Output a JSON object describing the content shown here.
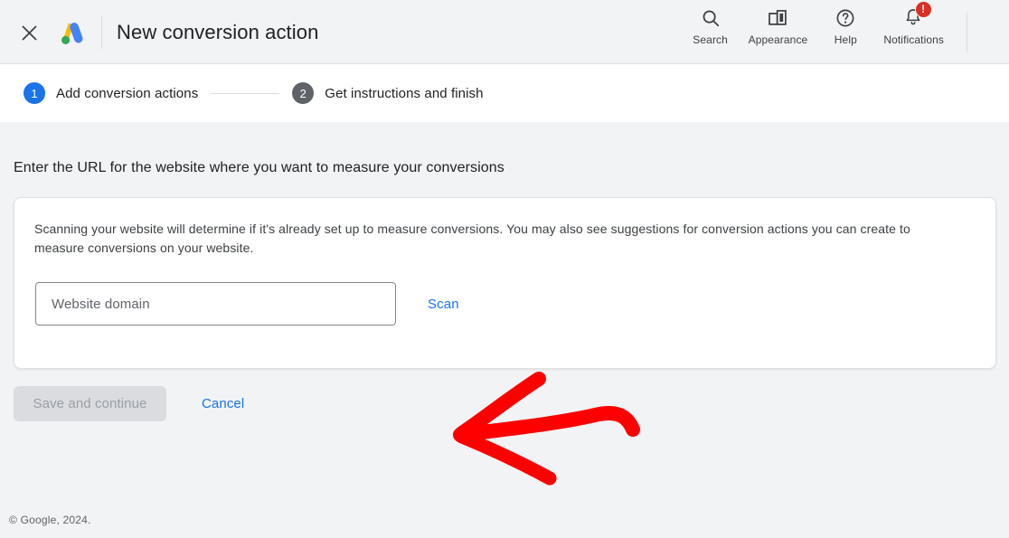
{
  "header": {
    "title": "New conversion action",
    "close_icon": "close-icon",
    "logo_icon": "google-ads-logo",
    "actions": [
      {
        "label": "Search",
        "icon": "search-icon"
      },
      {
        "label": "Appearance",
        "icon": "appearance-icon"
      },
      {
        "label": "Help",
        "icon": "help-icon"
      },
      {
        "label": "Notifications",
        "icon": "bell-icon",
        "badge": "!"
      }
    ]
  },
  "stepper": {
    "steps": [
      {
        "number": "1",
        "label": "Add conversion actions",
        "state": "active"
      },
      {
        "number": "2",
        "label": "Get instructions and finish",
        "state": "inactive"
      }
    ]
  },
  "main": {
    "heading": "Enter the URL for the website where you want to measure your conversions",
    "card": {
      "description": "Scanning your website will determine if it's already set up to measure conversions. You may also see suggestions for conversion actions you can create to measure conversions on your website.",
      "domain_input": {
        "value": "",
        "placeholder": "Website domain"
      },
      "scan_label": "Scan"
    },
    "actions": {
      "save_label": "Save and continue",
      "cancel_label": "Cancel"
    }
  },
  "footer": {
    "copyright": "© Google, 2024."
  },
  "annotation": {
    "type": "hand-drawn-arrow",
    "direction": "left",
    "color": "#FF0000"
  },
  "colors": {
    "accent_blue": "#1a73e8",
    "page_bg": "#f1f3f4",
    "card_bg": "#ffffff",
    "text_primary": "#202124",
    "text_secondary": "#3c4043",
    "badge_red": "#d93025",
    "annotation_red": "#FF0000",
    "disabled_btn": "#dadce0"
  }
}
